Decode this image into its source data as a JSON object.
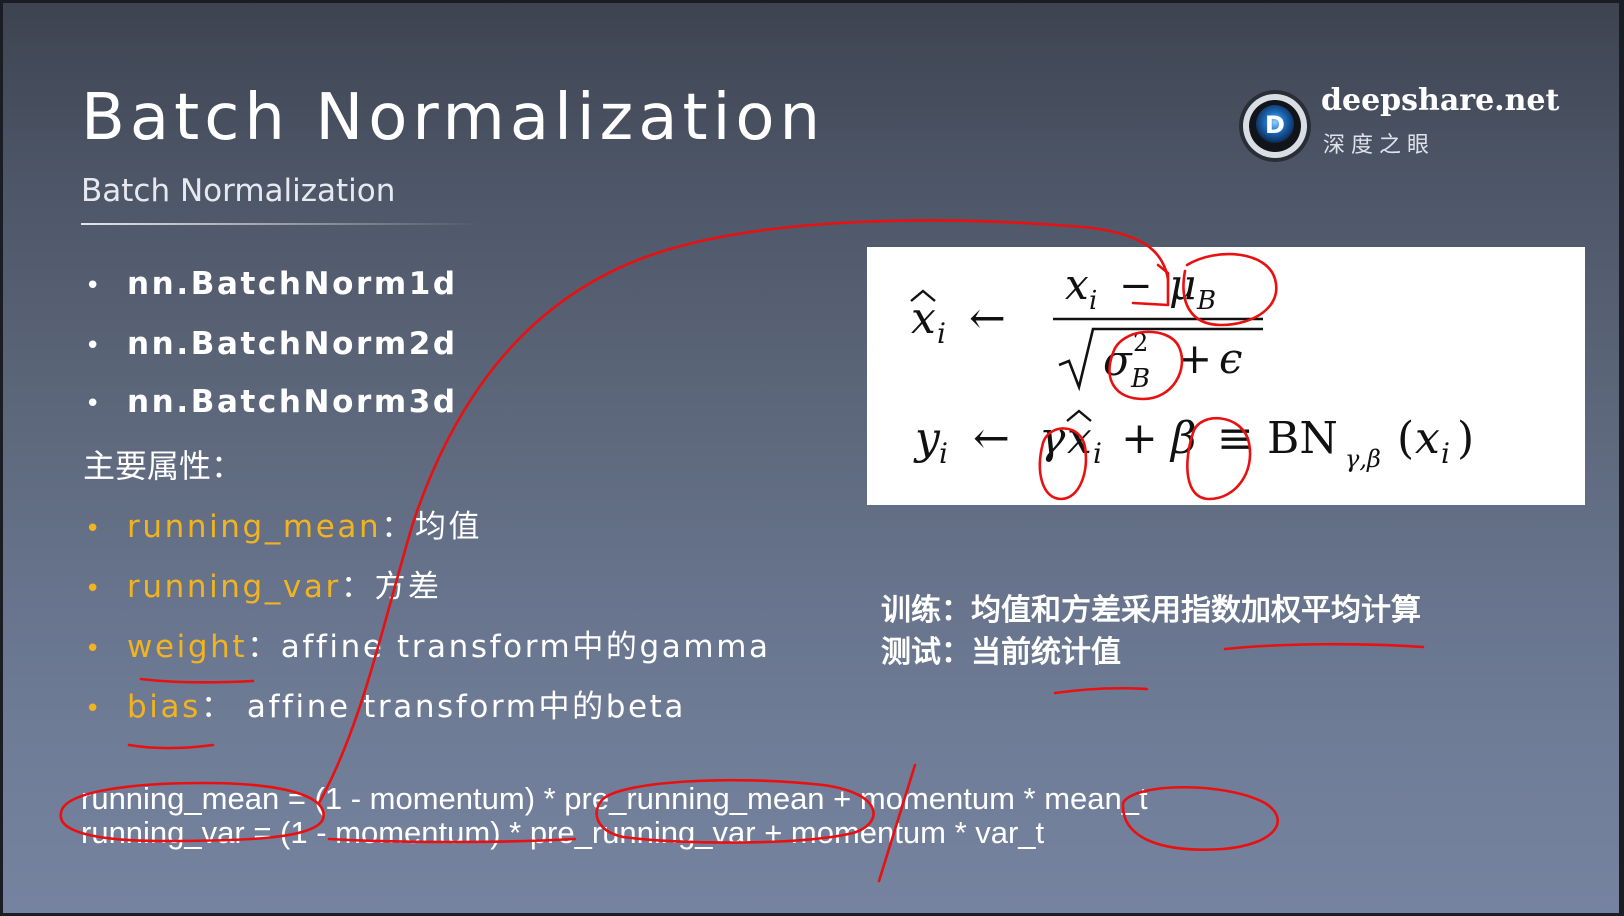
{
  "slide": {
    "title": "Batch Normalization",
    "subtitle": "Batch Normalization"
  },
  "logo": {
    "site": "deepshare.net",
    "name_cn": "深度之眼",
    "icon": "eye-logo-icon",
    "icon_letter": "D"
  },
  "modules": [
    "nn.BatchNorm1d",
    "nn.BatchNorm2d",
    "nn.BatchNorm3d"
  ],
  "attributes_heading": "主要属性：",
  "attributes": [
    {
      "name": "running_mean",
      "sep": "：",
      "desc": "均值"
    },
    {
      "name": "running_var",
      "sep": "：",
      "desc": "方差"
    },
    {
      "name": "weight",
      "sep": "：",
      "desc": "affine transform中的gamma"
    },
    {
      "name": "bias",
      "sep": "：",
      "desc": " affine transform中的beta"
    }
  ],
  "notes": {
    "train": "训练：均值和方差采用指数加权平均计算",
    "test": "测试：当前统计值"
  },
  "code": {
    "line1": "running_mean = (1 - momentum) * pre_running_mean + momentum * mean_t",
    "line2": "running_var = (1 - momentum) * pre_running_var + momentum * var_t"
  },
  "colors": {
    "accent": "#f2b320",
    "annotation": "#e81010",
    "text": "#ffffff"
  }
}
